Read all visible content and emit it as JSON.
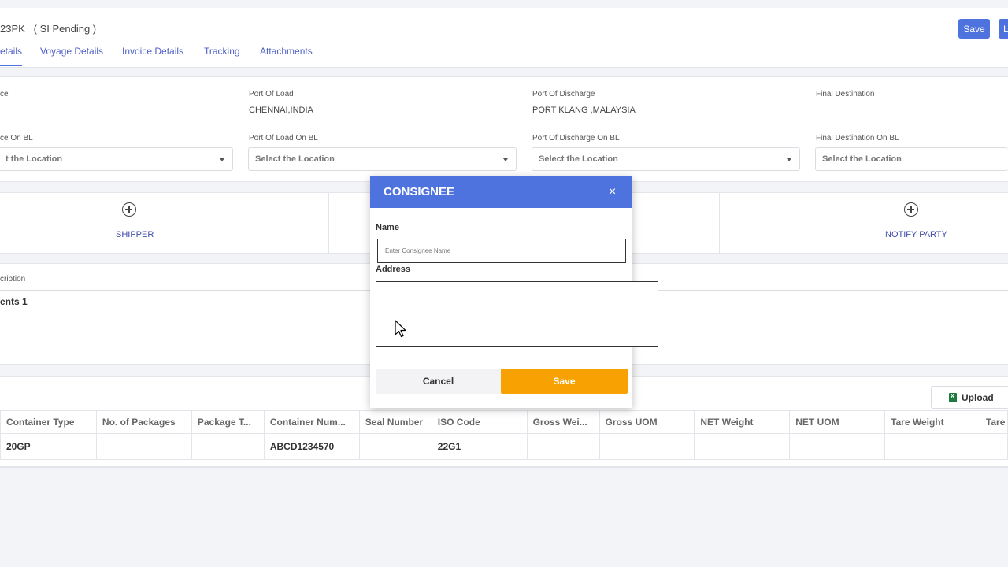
{
  "header": {
    "title": "23PK   ( SI Pending )",
    "save_label": "Save",
    "second_label": "L",
    "tabs": [
      "etails",
      "Voyage Details",
      "Invoice Details",
      "Tracking",
      "Attachments"
    ]
  },
  "locations": {
    "labels": [
      "ce",
      "Port Of Load",
      "Port Of Discharge",
      "Final Destination"
    ],
    "values": [
      "",
      "CHENNAI,INDIA",
      "PORT KLANG ,MALAYSIA",
      ""
    ],
    "bl_labels": [
      "ce On BL",
      "Port Of Load On BL",
      "Port Of Discharge On BL",
      "Final Destination On BL"
    ],
    "placeholders": [
      "t the Location",
      "Select the Location",
      "Select the Location",
      "Select the Location"
    ]
  },
  "parties": {
    "shipper": "SHIPPER",
    "notify": "NOTIFY PARTY"
  },
  "description": {
    "label": "cription",
    "value": "ents 1"
  },
  "containers": {
    "upload_label": "Upload",
    "columns": [
      "Container Type",
      "No. of Packages",
      "Package T...",
      "Container Num...",
      "Seal Number",
      "ISO Code",
      "Gross Wei...",
      "Gross UOM",
      "NET Weight",
      "NET UOM",
      "Tare Weight",
      "Tare"
    ],
    "rows": [
      [
        "20GP",
        "",
        "",
        "ABCD1234570",
        "",
        "22G1",
        "",
        "",
        "",
        "",
        "",
        ""
      ]
    ]
  },
  "modal": {
    "title": "CONSIGNEE",
    "close": "×",
    "name_label": "Name",
    "name_placeholder": "Enter Consignee Name",
    "address_label": "Address",
    "cancel_label": "Cancel",
    "save_label": "Save"
  },
  "colors": {
    "primary": "#4e73df",
    "save_orange": "#f7a102"
  }
}
